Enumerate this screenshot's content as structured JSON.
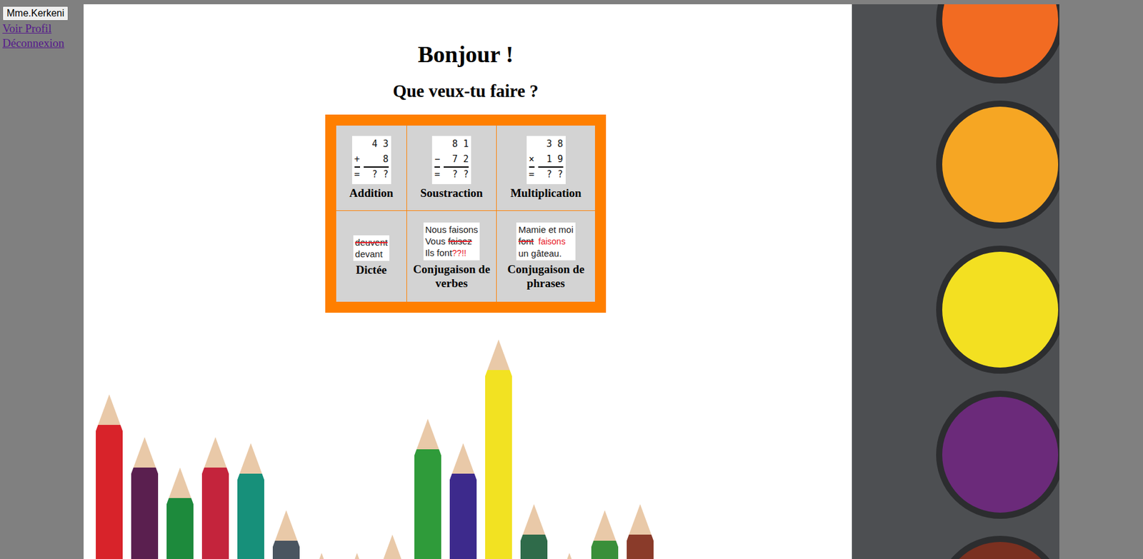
{
  "user": {
    "button": "Mme.Kerkeni",
    "links": [
      "Voir Profil",
      "Déconnexion"
    ]
  },
  "heading": "Bonjour !",
  "subheading": "Que veux-tu faire ?",
  "activities": [
    {
      "label": "Addition",
      "kind": "math",
      "rows": [
        {
          "op": "",
          "digits": "4 3"
        },
        {
          "op": "+",
          "digits": "8"
        },
        {
          "op": "=",
          "digits": "? ?"
        }
      ]
    },
    {
      "label": "Soustraction",
      "kind": "math",
      "rows": [
        {
          "op": "",
          "digits": "8 1"
        },
        {
          "op": "−",
          "digits": "7 2"
        },
        {
          "op": "=",
          "digits": "? ?"
        }
      ]
    },
    {
      "label": "Multiplication",
      "kind": "math",
      "rows": [
        {
          "op": "",
          "digits": "3 8"
        },
        {
          "op": "×",
          "digits": "1 9"
        },
        {
          "op": "=",
          "digits": "? ?"
        }
      ]
    },
    {
      "label": "Dictée",
      "kind": "text",
      "lines": [
        [
          {
            "text": "deuvent",
            "style": "struck"
          }
        ],
        [
          {
            "text": "devant",
            "style": "plain"
          }
        ]
      ]
    },
    {
      "label": "Conjugaison de verbes",
      "kind": "text",
      "lines": [
        [
          {
            "text": "Nous faisons",
            "style": "plain"
          }
        ],
        [
          {
            "text": "Vous ",
            "style": "plain"
          },
          {
            "text": "faisez",
            "style": "struck"
          }
        ],
        [
          {
            "text": "Ils font",
            "style": "plain"
          },
          {
            "text": "??!!",
            "style": "red"
          }
        ]
      ]
    },
    {
      "label": "Conjugaison de phrases",
      "kind": "text",
      "lines": [
        [
          {
            "text": "Mamie et moi",
            "style": "plain"
          }
        ],
        [
          {
            "text": "font",
            "style": "struck"
          },
          {
            "text": "  faisons",
            "style": "red"
          }
        ],
        [
          {
            "text": "un gâteau.",
            "style": "plain"
          }
        ]
      ]
    }
  ]
}
